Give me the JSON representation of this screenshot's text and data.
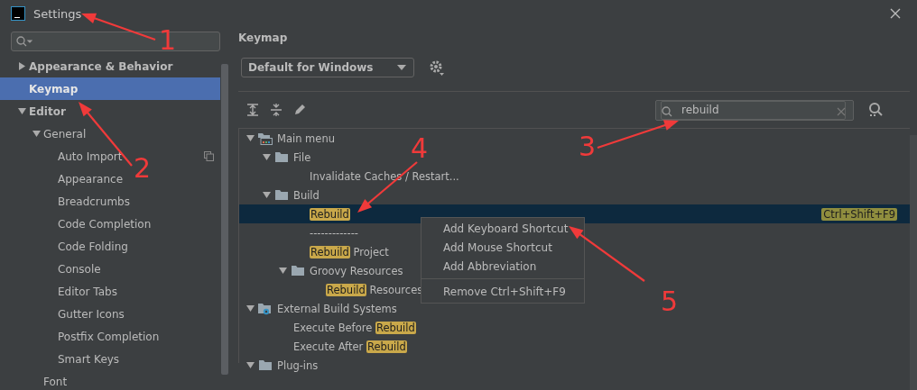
{
  "window": {
    "title": "Settings"
  },
  "sidebar": {
    "tree": [
      {
        "label": "Appearance & Behavior",
        "expanded": false,
        "selected": false
      },
      {
        "label": "Keymap",
        "selected": true
      },
      {
        "label": "Editor",
        "expanded": true,
        "selected": false,
        "children": [
          {
            "label": "General",
            "expanded": true,
            "selected": false,
            "children": [
              {
                "label": "Auto Import",
                "selected": false,
                "project_level": true
              },
              {
                "label": "Appearance",
                "selected": false
              },
              {
                "label": "Breadcrumbs",
                "selected": false
              },
              {
                "label": "Code Completion",
                "selected": false
              },
              {
                "label": "Code Folding",
                "selected": false
              },
              {
                "label": "Console",
                "selected": false
              },
              {
                "label": "Editor Tabs",
                "selected": false
              },
              {
                "label": "Gutter Icons",
                "selected": false
              },
              {
                "label": "Postfix Completion",
                "selected": false
              },
              {
                "label": "Smart Keys",
                "selected": false
              }
            ]
          },
          {
            "label": "Font",
            "selected": false
          }
        ]
      }
    ]
  },
  "keymap": {
    "title": "Keymap",
    "scheme": "Default for Windows",
    "search": {
      "value": "rebuild"
    },
    "tree": [
      {
        "kind": "main-menu",
        "label": "Main menu",
        "expanded": true,
        "selected": false,
        "children": [
          {
            "kind": "folder",
            "label": "File",
            "expanded": true,
            "selected": false,
            "children": [
              {
                "kind": "action",
                "label": "Invalidate Caches / Restart...",
                "selected": false
              }
            ]
          },
          {
            "kind": "folder",
            "label": "Build",
            "expanded": true,
            "selected": false,
            "children": [
              {
                "kind": "action",
                "label": "**Rebuild**",
                "selected": true,
                "shortcut": "Ctrl+Shift+F9"
              },
              {
                "kind": "action",
                "label": "-------------",
                "selected": false
              },
              {
                "kind": "action",
                "label": "**Rebuild** Project",
                "selected": false
              },
              {
                "kind": "folder",
                "label": "Groovy Resources",
                "expanded": true,
                "selected": false,
                "children": [
                  {
                    "kind": "action",
                    "label": "**Rebuild** Resources",
                    "selected": false
                  }
                ]
              }
            ]
          }
        ]
      },
      {
        "kind": "external",
        "label": "External Build Systems",
        "expanded": true,
        "selected": false,
        "children": [
          {
            "kind": "action",
            "label": "Execute Before **Rebuild**",
            "selected": false
          },
          {
            "kind": "action",
            "label": "Execute After **Rebuild**",
            "selected": false
          }
        ]
      },
      {
        "kind": "folder",
        "label": "Plug-ins",
        "expanded": true,
        "selected": false
      }
    ]
  },
  "context_menu": {
    "groups": [
      [
        "Add Keyboard Shortcut",
        "Add Mouse Shortcut",
        "Add Abbreviation"
      ],
      [
        "Remove Ctrl+Shift+F9"
      ]
    ]
  },
  "annotations": [
    {
      "number": "1"
    },
    {
      "number": "2"
    },
    {
      "number": "3"
    },
    {
      "number": "4"
    },
    {
      "number": "5"
    }
  ]
}
